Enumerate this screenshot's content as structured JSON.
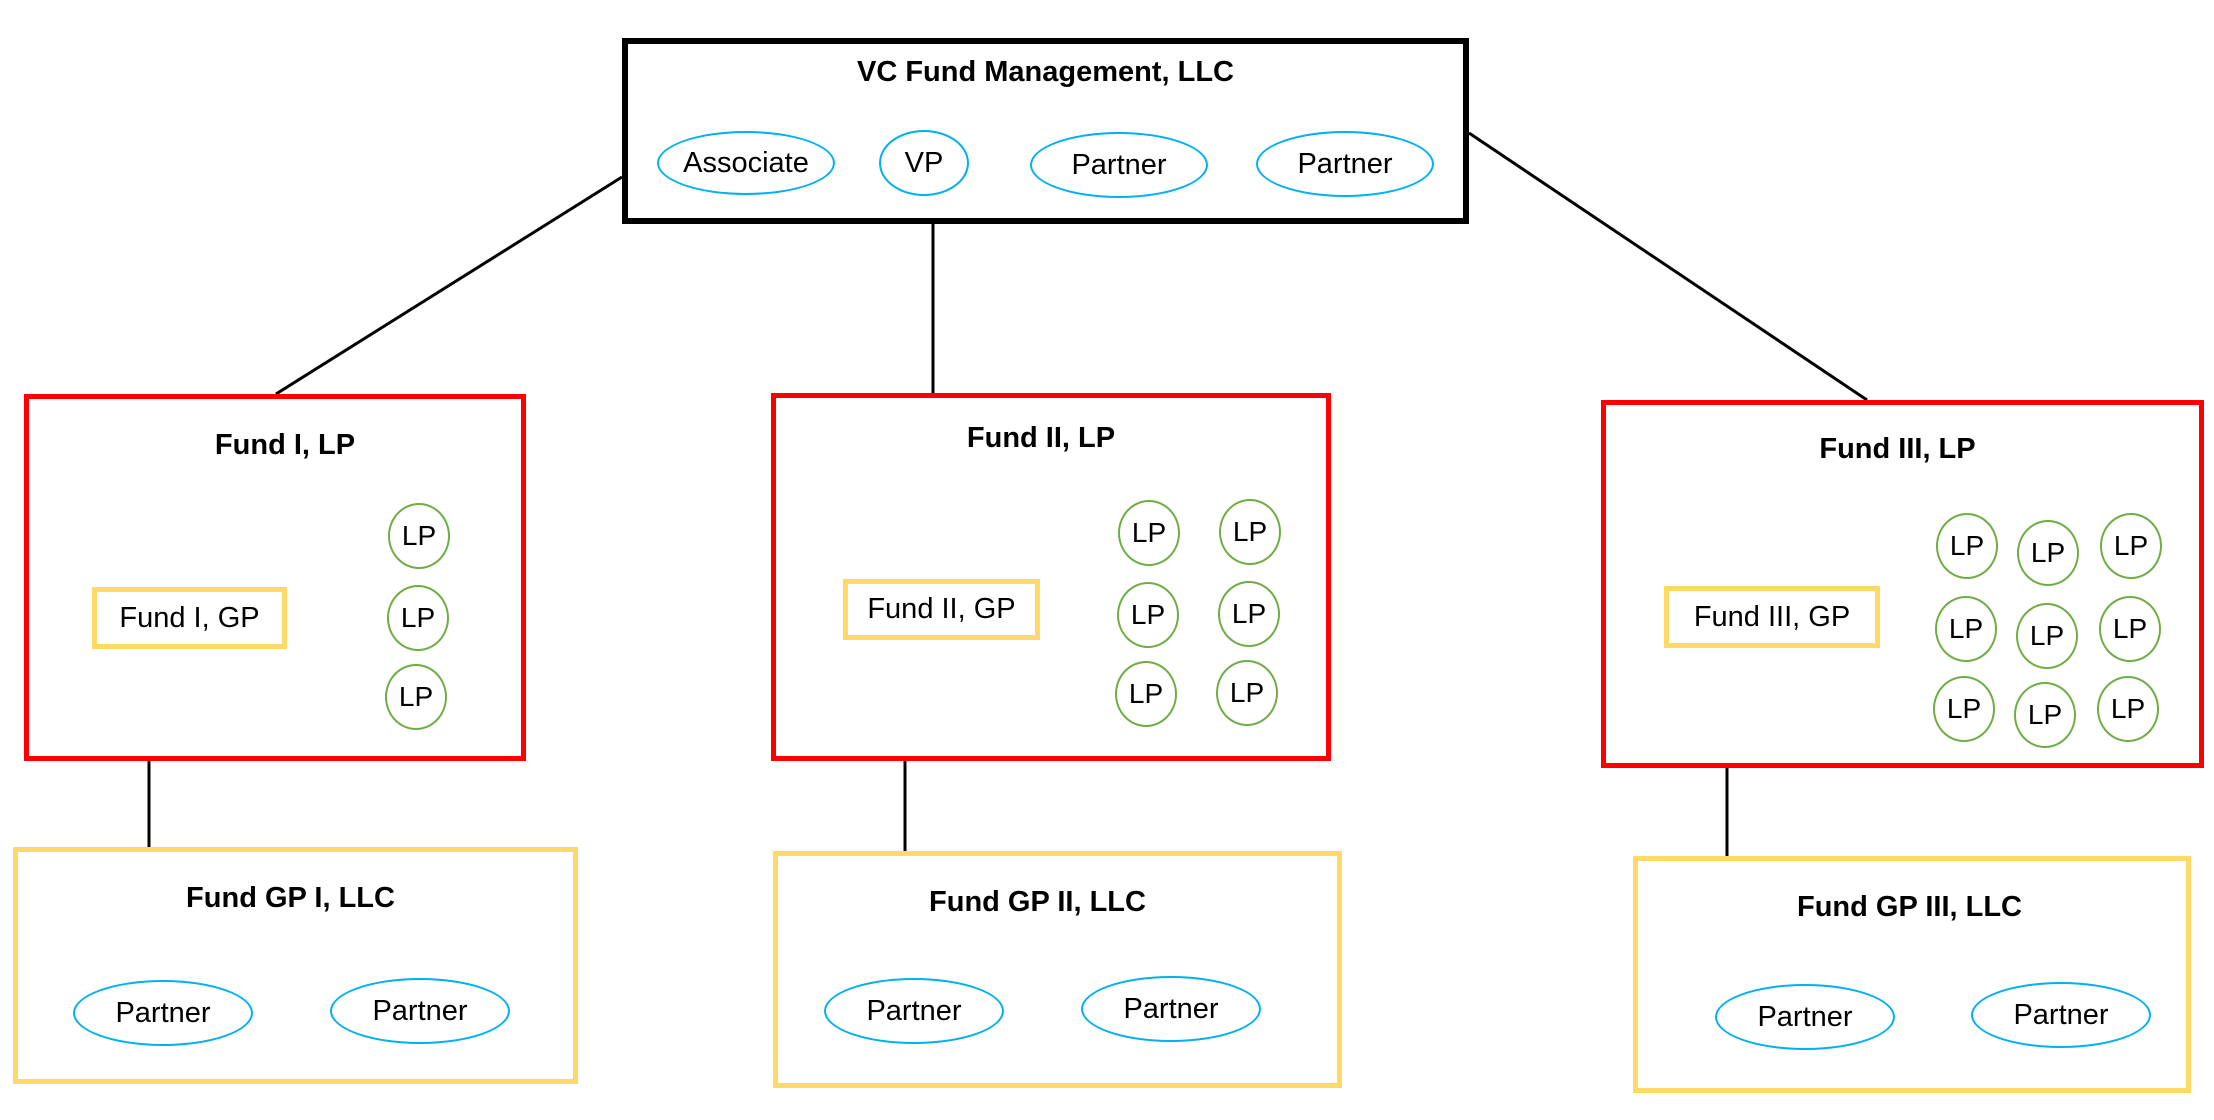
{
  "management": {
    "title": "VC Fund Management, LLC",
    "members": [
      "Associate",
      "VP",
      "Partner",
      "Partner"
    ]
  },
  "funds": [
    {
      "title": "Fund I, LP",
      "gp_label": "Fund I, GP",
      "lp_label": "LP",
      "lp_count": 3
    },
    {
      "title": "Fund II, LP",
      "gp_label": "Fund II, GP",
      "lp_label": "LP",
      "lp_count": 6
    },
    {
      "title": "Fund III, LP",
      "gp_label": "Fund III, GP",
      "lp_label": "LP",
      "lp_count": 9
    }
  ],
  "gp_entities": [
    {
      "title": "Fund GP I, LLC",
      "members": [
        "Partner",
        "Partner"
      ]
    },
    {
      "title": "Fund GP II, LLC",
      "members": [
        "Partner",
        "Partner"
      ]
    },
    {
      "title": "Fund GP III, LLC",
      "members": [
        "Partner",
        "Partner"
      ]
    }
  ],
  "colors": {
    "management_border": "#000000",
    "fund_border": "#ff0000",
    "gp_border": "#ffd966",
    "person_ellipse": "#00b0f0",
    "lp_circle": "#70ad47"
  }
}
